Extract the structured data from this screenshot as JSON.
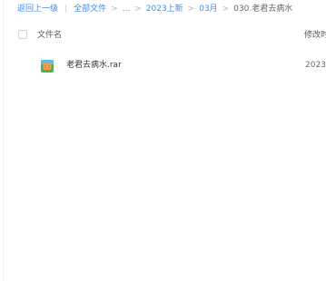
{
  "breadcrumb": {
    "back": "返回上一级",
    "divider": "|",
    "items": [
      "全部文件",
      "...",
      "2023上新",
      "03月"
    ],
    "separator": ">",
    "current": "030.老君去病水"
  },
  "table": {
    "columns": {
      "name": "文件名",
      "modified": "修改时间"
    },
    "rows": [
      {
        "name": "老君去病水.rar",
        "modified": "2023-",
        "icon": "archive-file-icon"
      }
    ]
  },
  "colors": {
    "link": "#3b8cf5",
    "text": "#333333",
    "muted": "#666666"
  }
}
